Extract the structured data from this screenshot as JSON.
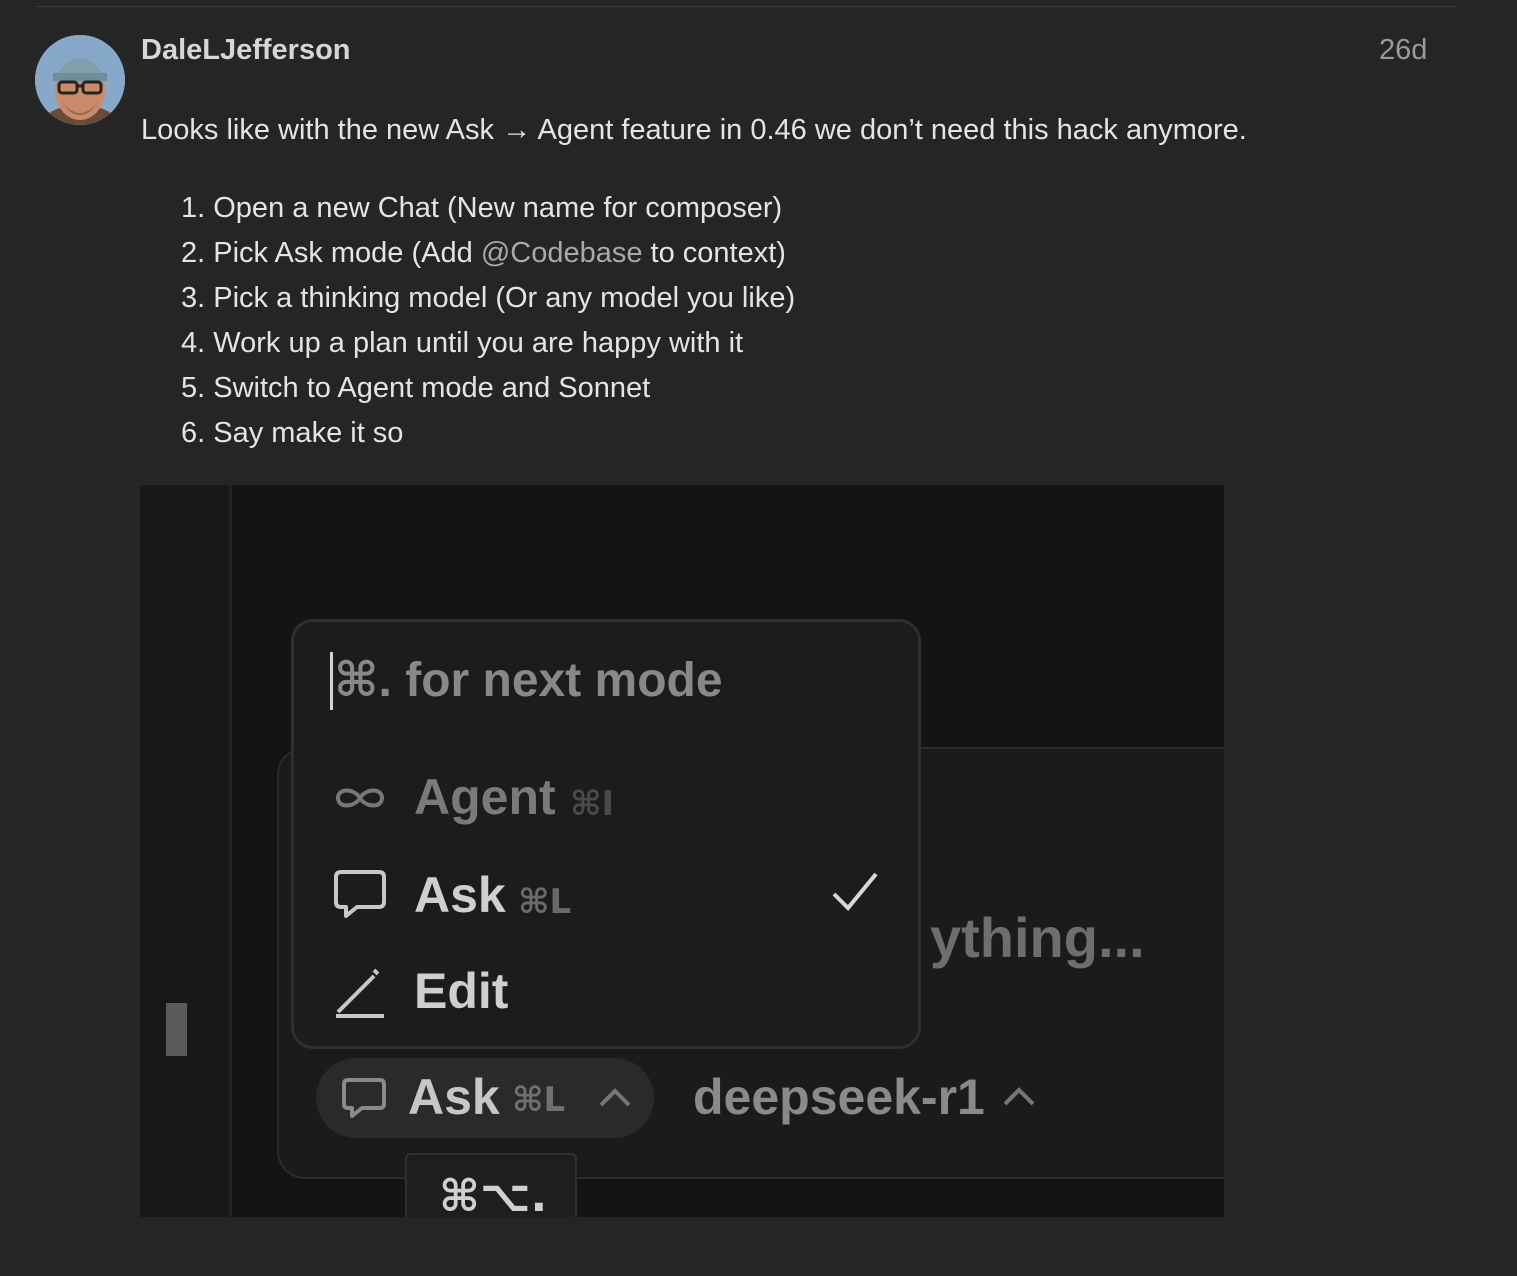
{
  "post": {
    "author": "DaleLJefferson",
    "date": "26d",
    "intro": "Looks like with the new Ask → Agent feature in 0.46 we don’t need this hack anymore.",
    "steps": [
      {
        "num": "1.",
        "text": "Open a new Chat (New name for composer)"
      },
      {
        "num": "2.",
        "before": "Pick Ask mode (Add ",
        "mention": "@Codebase",
        "after": " to context)"
      },
      {
        "num": "3.",
        "text": "Pick a thinking model (Or any model you like)"
      },
      {
        "num": "4.",
        "text": "Work up a plan until you are happy with it"
      },
      {
        "num": "5.",
        "text": "Switch to Agent mode and Sonnet"
      },
      {
        "num": "6.",
        "text": "Say make it so"
      }
    ]
  },
  "screenshot": {
    "search_placeholder": "⌘. for next mode",
    "modes": [
      {
        "label": "Agent",
        "shortcut": "⌘I",
        "icon": "infinity-icon",
        "selected": false
      },
      {
        "label": "Ask",
        "shortcut": "⌘L",
        "icon": "chat-bubble-icon",
        "selected": true
      },
      {
        "label": "Edit",
        "shortcut": "",
        "icon": "pencil-icon",
        "selected": false
      }
    ],
    "composer_placeholder_visible": "ything...",
    "current_mode": {
      "label": "Ask",
      "shortcut": "⌘L"
    },
    "model": "deepseek-r1",
    "tooltip": "⌘⌥."
  }
}
